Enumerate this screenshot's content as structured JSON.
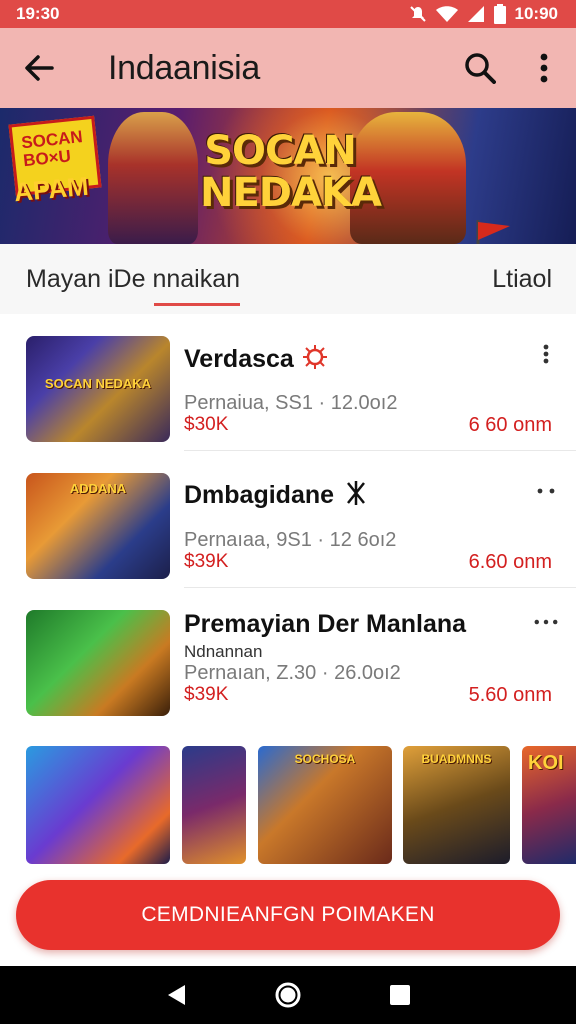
{
  "status_bar": {
    "time": "19:30",
    "battery_text": "10:90"
  },
  "app_bar": {
    "title": "Indaanisia"
  },
  "banner": {
    "badge_text": "SOCAN\nBO×U",
    "badge_tag": "APAM",
    "logo_line1": "SOCAN",
    "logo_line2": "NEDAKA"
  },
  "section": {
    "title": "Mayan iDe nnaikan",
    "link": "Ltiaol"
  },
  "games": [
    {
      "title": "Verdasca",
      "subtitle": "Pernaiua, SS1 · 12.0oı2",
      "price": "$30K",
      "size": "6 60 onm"
    },
    {
      "title": "Dmbagidane",
      "subtitle": "Pernaıaa, 9S1 · 12 6oı2",
      "price": "$39K",
      "size": "6.60 onm"
    },
    {
      "title": "Premayian Der Manlana",
      "subtitle_small": "Ndnannan",
      "subtitle": "Pernaıan, Z.30 · 26.0oı2",
      "price": "$39K",
      "size": "5.60 onm"
    }
  ],
  "thumb_labels": [
    "SOCAN NEDAKA",
    "ADDANA",
    ""
  ],
  "strip": [
    "",
    "",
    "SOCHOSA",
    "BUADMNNS",
    "KOI"
  ],
  "cta": {
    "label": "CEMDNIEANFGN POIMAKEN"
  },
  "colors": {
    "accent": "#e8322d",
    "appbar": "#f2b6b2",
    "statusbar": "#e04a47"
  }
}
